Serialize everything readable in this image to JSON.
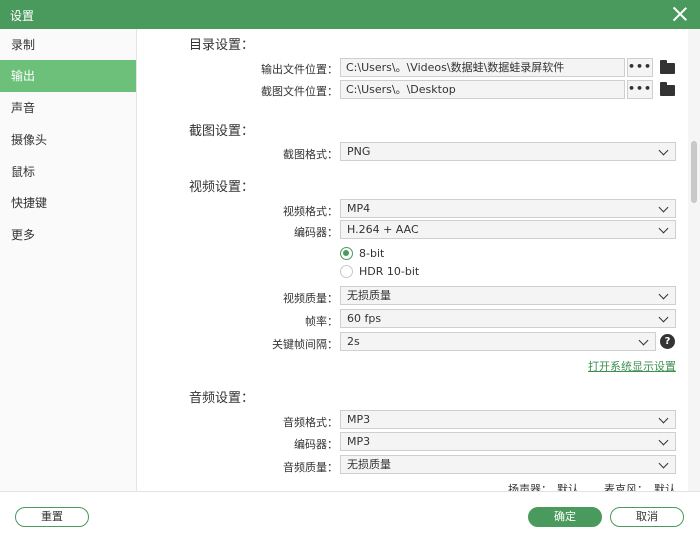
{
  "window": {
    "title": "设置"
  },
  "sidebar": {
    "items": [
      {
        "label": "录制",
        "active": false
      },
      {
        "label": "输出",
        "active": true
      },
      {
        "label": "声音",
        "active": false
      },
      {
        "label": "摄像头",
        "active": false
      },
      {
        "label": "鼠标",
        "active": false
      },
      {
        "label": "快捷键",
        "active": false
      },
      {
        "label": "更多",
        "active": false
      }
    ]
  },
  "directory": {
    "section_title": "目录设置：",
    "output_label": "输出文件位置：",
    "output_path": "C:\\Users\\。\\Videos\\数据蛙\\数据蛙录屏软件",
    "screenshot_label": "截图文件位置：",
    "screenshot_path": "C:\\Users\\。\\Desktop",
    "browse_label": "•••"
  },
  "screenshot": {
    "section_title": "截图设置：",
    "format_label": "截图格式：",
    "format_value": "PNG"
  },
  "video": {
    "section_title": "视频设置：",
    "format_label": "视频格式：",
    "format_value": "MP4",
    "encoder_label": "编码器：",
    "encoder_value": "H.264 + AAC",
    "bitdepth_options": [
      {
        "label": "8-bit",
        "checked": true
      },
      {
        "label": "HDR 10-bit",
        "checked": false
      }
    ],
    "quality_label": "视频质量：",
    "quality_value": "无损质量",
    "fps_label": "帧率：",
    "fps_value": "60 fps",
    "keyframe_label": "关键帧间隔：",
    "keyframe_value": "2s",
    "help_glyph": "?",
    "display_settings_link": "打开系统显示设置"
  },
  "audio": {
    "section_title": "音频设置：",
    "format_label": "音频格式：",
    "format_value": "MP3",
    "encoder_label": "编码器：",
    "encoder_value": "MP3",
    "quality_label": "音频质量：",
    "quality_value": "无损质量",
    "speaker_label": "扬声器：",
    "speaker_value": "默认",
    "mic_label": "麦克风：",
    "mic_value": "默认"
  },
  "footer": {
    "reset_label": "重置",
    "ok_label": "确定",
    "cancel_label": "取消"
  },
  "colors": {
    "accent": "#4a9a5e",
    "nav_active": "#6cc07a",
    "link": "#3d8f52"
  }
}
